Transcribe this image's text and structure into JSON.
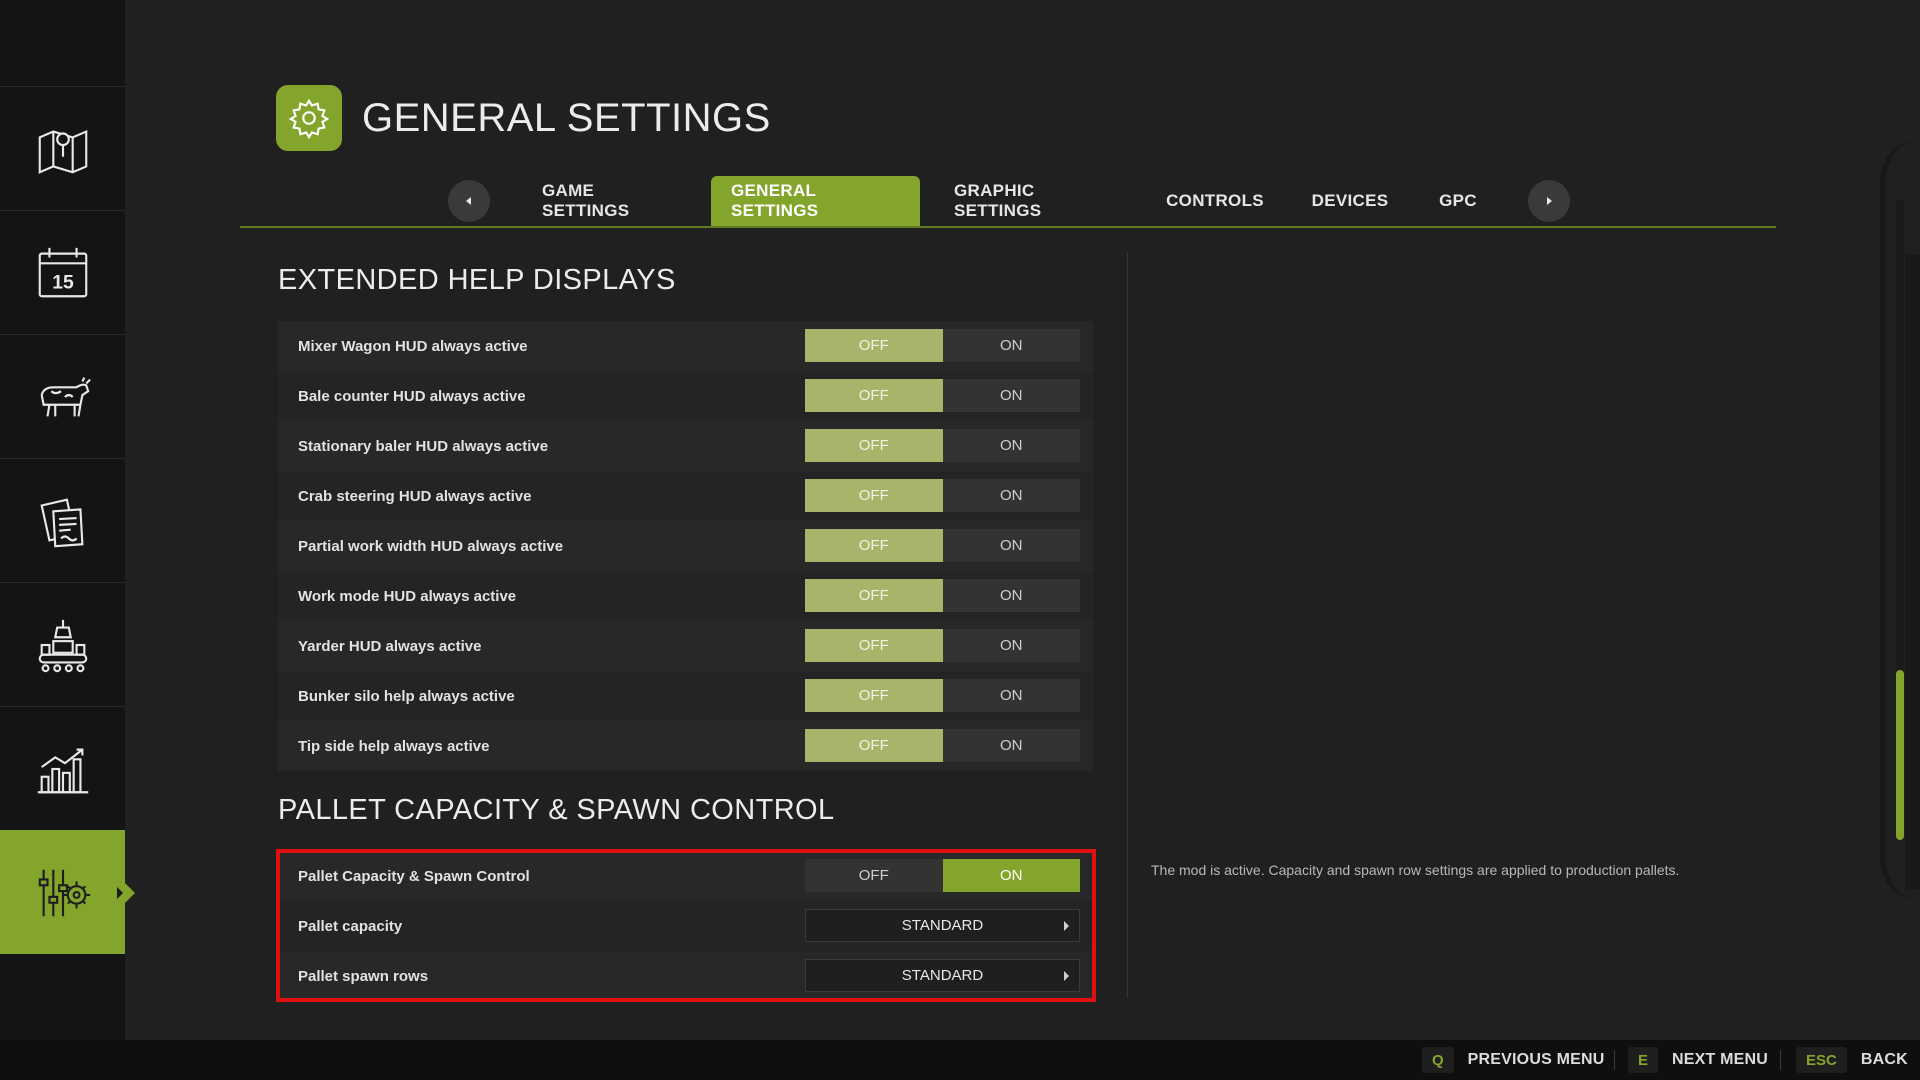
{
  "header": {
    "title": "GENERAL SETTINGS",
    "icon": "gear-icon"
  },
  "sidebar": {
    "items": [
      {
        "name": "map",
        "icon": "map-icon",
        "active": false
      },
      {
        "name": "calendar",
        "icon": "calendar-icon",
        "label": "15",
        "active": false
      },
      {
        "name": "animals",
        "icon": "cow-icon",
        "active": false
      },
      {
        "name": "contracts",
        "icon": "documents-icon",
        "active": false
      },
      {
        "name": "production",
        "icon": "factory-icon",
        "active": false
      },
      {
        "name": "statistics",
        "icon": "bar-chart-icon",
        "active": false
      },
      {
        "name": "settings",
        "icon": "settings-sliders-icon",
        "active": true
      }
    ]
  },
  "tabs": [
    {
      "label": "GAME SETTINGS",
      "active": false
    },
    {
      "label": "GENERAL SETTINGS",
      "active": true
    },
    {
      "label": "GRAPHIC SETTINGS",
      "active": false
    },
    {
      "label": "CONTROLS",
      "active": false
    },
    {
      "label": "DEVICES",
      "active": false
    },
    {
      "label": "GPC",
      "active": false
    }
  ],
  "sections": {
    "help": {
      "title": "EXTENDED HELP DISPLAYS",
      "rows": [
        {
          "label": "Mixer Wagon HUD always active",
          "off": "OFF",
          "on": "ON",
          "value": "OFF"
        },
        {
          "label": "Bale counter HUD always active",
          "off": "OFF",
          "on": "ON",
          "value": "OFF"
        },
        {
          "label": "Stationary baler HUD always active",
          "off": "OFF",
          "on": "ON",
          "value": "OFF"
        },
        {
          "label": "Crab steering HUD always active",
          "off": "OFF",
          "on": "ON",
          "value": "OFF"
        },
        {
          "label": "Partial work width HUD always active",
          "off": "OFF",
          "on": "ON",
          "value": "OFF"
        },
        {
          "label": "Work mode HUD always active",
          "off": "OFF",
          "on": "ON",
          "value": "OFF"
        },
        {
          "label": "Yarder HUD always active",
          "off": "OFF",
          "on": "ON",
          "value": "OFF"
        },
        {
          "label": "Bunker silo help always active",
          "off": "OFF",
          "on": "ON",
          "value": "OFF"
        },
        {
          "label": "Tip side help always active",
          "off": "OFF",
          "on": "ON",
          "value": "OFF"
        }
      ]
    },
    "pallet": {
      "title": "PALLET CAPACITY & SPAWN CONTROL",
      "toggle": {
        "label": "Pallet Capacity & Spawn Control",
        "off": "OFF",
        "on": "ON",
        "value": "ON"
      },
      "capacity": {
        "label": "Pallet capacity",
        "value": "STANDARD"
      },
      "spawn_rows": {
        "label": "Pallet spawn rows",
        "value": "STANDARD"
      }
    }
  },
  "info_text": "The mod is active. Capacity and spawn row settings are applied to production pallets.",
  "footer": {
    "hints": [
      {
        "key": "Q",
        "label": "PREVIOUS MENU"
      },
      {
        "key": "E",
        "label": "NEXT MENU"
      },
      {
        "key": "ESC",
        "label": "BACK"
      }
    ]
  },
  "colors": {
    "accent": "#84a52b",
    "off_selected": "#a8b46a",
    "highlight": "#e01010",
    "background": "#202020",
    "sidebar": "#141414"
  }
}
